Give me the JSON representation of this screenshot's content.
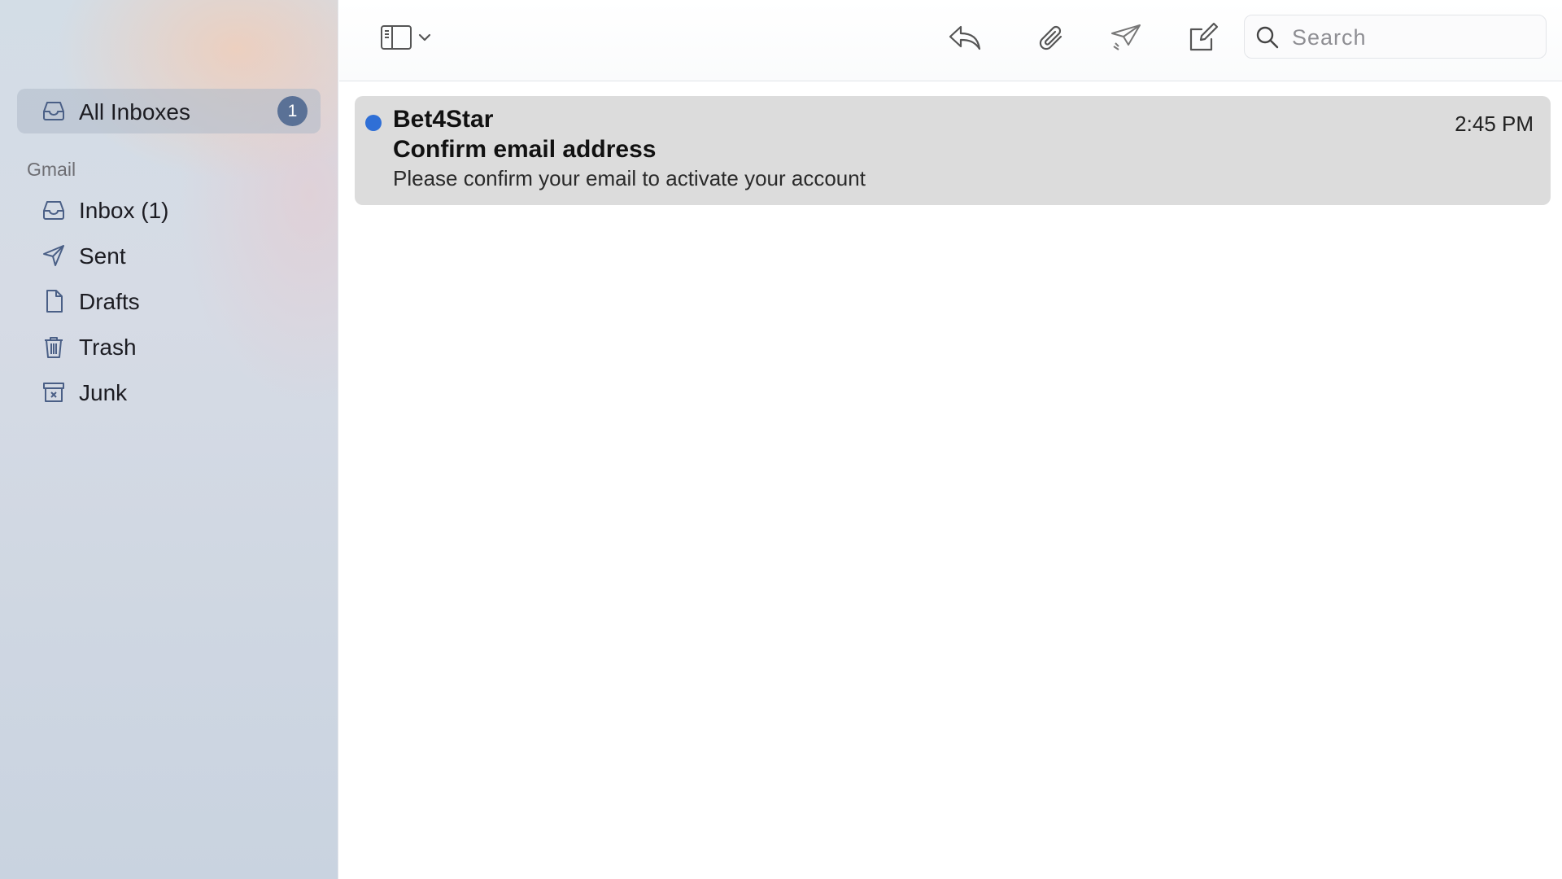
{
  "sidebar": {
    "all_inboxes": {
      "label": "All Inboxes",
      "badge": "1",
      "icon": "tray-icon"
    },
    "section_header": "Gmail",
    "items": [
      {
        "label": "Inbox (1)",
        "icon": "tray-icon"
      },
      {
        "label": "Sent",
        "icon": "paper-plane-icon"
      },
      {
        "label": "Drafts",
        "icon": "document-icon"
      },
      {
        "label": "Trash",
        "icon": "trash-icon"
      },
      {
        "label": "Junk",
        "icon": "junk-box-icon"
      }
    ]
  },
  "toolbar": {
    "icons": [
      "sidebar-toggle-icon",
      "chevron-down-icon",
      "reply-icon",
      "paperclip-icon",
      "send-icon",
      "compose-icon",
      "search-icon"
    ],
    "search_placeholder": "Search",
    "search_value": ""
  },
  "messages": [
    {
      "unread": true,
      "sender": "Bet4Star",
      "time": "2:45 PM",
      "subject": "Confirm email address",
      "preview": "Please confirm your email to activate your account"
    }
  ],
  "colors": {
    "unread_dot": "#2f6fd6",
    "badge": "#5a7196",
    "selected_row": "#dcdcdc",
    "icon_stroke": "#4a5f86"
  }
}
